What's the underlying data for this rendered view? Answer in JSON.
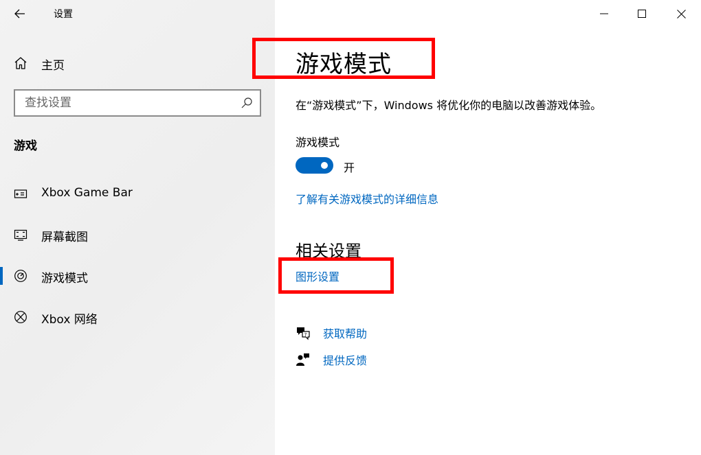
{
  "window": {
    "title": "设置"
  },
  "sidebar": {
    "home_label": "主页",
    "search_placeholder": "查找设置",
    "section_title": "游戏",
    "items": [
      {
        "label": "Xbox Game Bar",
        "icon": "game-bar-icon",
        "selected": false
      },
      {
        "label": "屏幕截图",
        "icon": "capture-icon",
        "selected": false
      },
      {
        "label": "游戏模式",
        "icon": "game-mode-icon",
        "selected": true
      },
      {
        "label": "Xbox 网络",
        "icon": "xbox-icon",
        "selected": false
      }
    ]
  },
  "main": {
    "title": "游戏模式",
    "description": "在“游戏模式”下，Windows 将优化你的电脑以改善游戏体验。",
    "setting_label": "游戏模式",
    "toggle_state": "开",
    "toggle_on": true,
    "learn_more_link": "了解有关游戏模式的详细信息",
    "related_title": "相关设置",
    "graphics_link": "图形设置",
    "help_link": "获取帮助",
    "feedback_link": "提供反馈"
  },
  "colors": {
    "accent": "#0067c0",
    "annotation": "#ff0000",
    "sidebar_bg": "#f2f2f2"
  }
}
